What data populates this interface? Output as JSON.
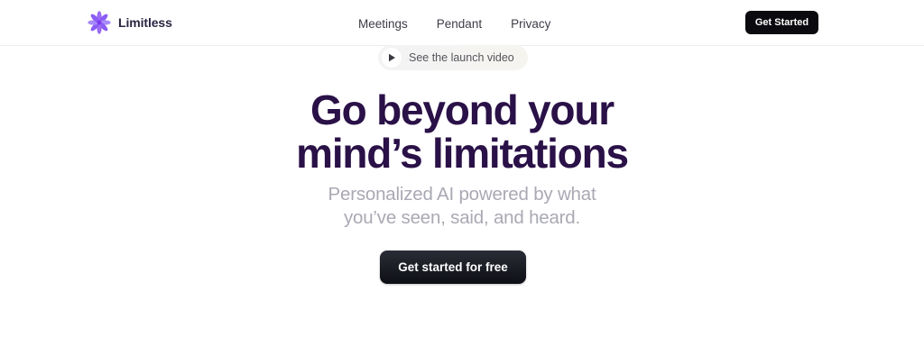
{
  "brand": {
    "name": "Limitless",
    "icon": "asterisk-flower-icon",
    "icon_color": "#8b5cf6"
  },
  "nav": {
    "links": [
      "Meetings",
      "Pendant",
      "Privacy"
    ],
    "cta_label": "Get Started"
  },
  "video": {
    "label": "See the launch video",
    "icon": "play-icon"
  },
  "hero": {
    "headline": [
      "Go beyond your",
      "mind’s limitations"
    ],
    "subheadline": [
      "Personalized AI powered by what",
      "you’ve seen, said, and heard."
    ],
    "cta_label": "Get started for free"
  },
  "colors": {
    "headline": "#2a1147",
    "subheadline": "#a9a9b4",
    "button_dark": "#0b0b0f"
  }
}
